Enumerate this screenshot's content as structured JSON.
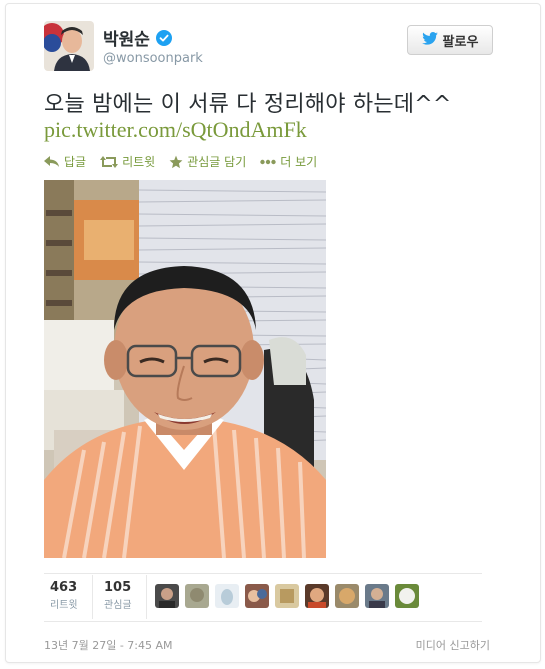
{
  "user": {
    "display_name": "박원순",
    "username": "@wonsoonpark",
    "verified": true
  },
  "follow_button": {
    "label": "팔로우",
    "icon": "twitter-bird-icon"
  },
  "tweet": {
    "text": "오늘 밤에는 이 서류 다 정리해야 하는데^^",
    "link": "pic.twitter.com/sQtOndAmFk"
  },
  "actions": [
    {
      "label": "답글",
      "icon": "reply-icon"
    },
    {
      "label": "리트윗",
      "icon": "retweet-icon"
    },
    {
      "label": "관심글 담기",
      "icon": "star-icon"
    },
    {
      "label": "더 보기",
      "icon": "more-icon"
    }
  ],
  "stats": {
    "retweets": {
      "count": "463",
      "label": "리트윗"
    },
    "favorites": {
      "count": "105",
      "label": "관심글"
    }
  },
  "footer": {
    "timestamp": "13년 7월 27일 - 7:45 AM",
    "report": "미디어 신고하기"
  },
  "colors": {
    "link": "#7a9a3b",
    "verified": "#1da1f2",
    "twitter_blue": "#2aa3ef"
  }
}
